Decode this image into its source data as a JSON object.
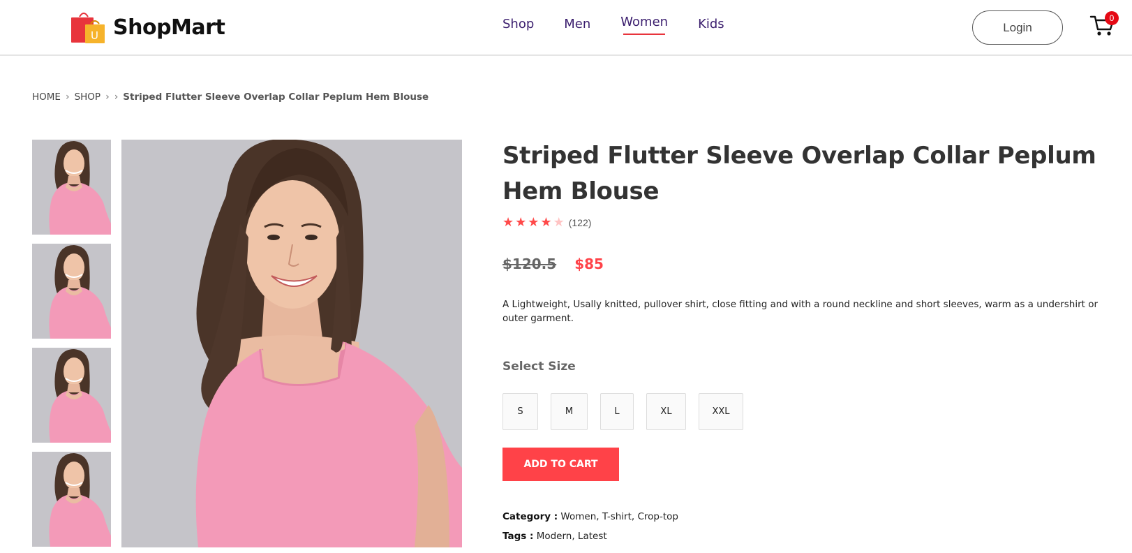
{
  "brand": {
    "name": "ShopMart",
    "logo_letter": "U"
  },
  "nav": {
    "items": [
      {
        "label": "Shop",
        "active": false
      },
      {
        "label": "Men",
        "active": false
      },
      {
        "label": "Women",
        "active": true
      },
      {
        "label": "Kids",
        "active": false
      }
    ]
  },
  "header": {
    "login_label": "Login",
    "cart_count": "0"
  },
  "breadcrumb": {
    "items": [
      "HOME",
      "SHOP"
    ],
    "current": "Striped Flutter Sleeve Overlap Collar Peplum Hem Blouse"
  },
  "product": {
    "title": "Striped Flutter Sleeve Overlap Collar Peplum Hem Blouse",
    "rating": 4,
    "rating_max": 5,
    "review_count": "(122)",
    "old_price": "$120.5",
    "price": "$85",
    "description": "A Lightweight, Usally knitted, pullover shirt, close fitting and with a round neckline and short sleeves, warm as a undershirt or outer garment.",
    "size_label": "Select Size",
    "sizes": [
      "S",
      "M",
      "L",
      "XL",
      "XXL"
    ],
    "add_to_cart_label": "ADD TO CART",
    "category_label": "Category :",
    "category_value": "Women, T-shirt, Crop-top",
    "tags_label": "Tags :",
    "tags_value": "Modern, Latest"
  },
  "colors": {
    "accent": "#ff4248",
    "nav_text": "#3b1e6e",
    "shirt": "#f39ab8",
    "photo_bg": "#c5c4c9"
  }
}
